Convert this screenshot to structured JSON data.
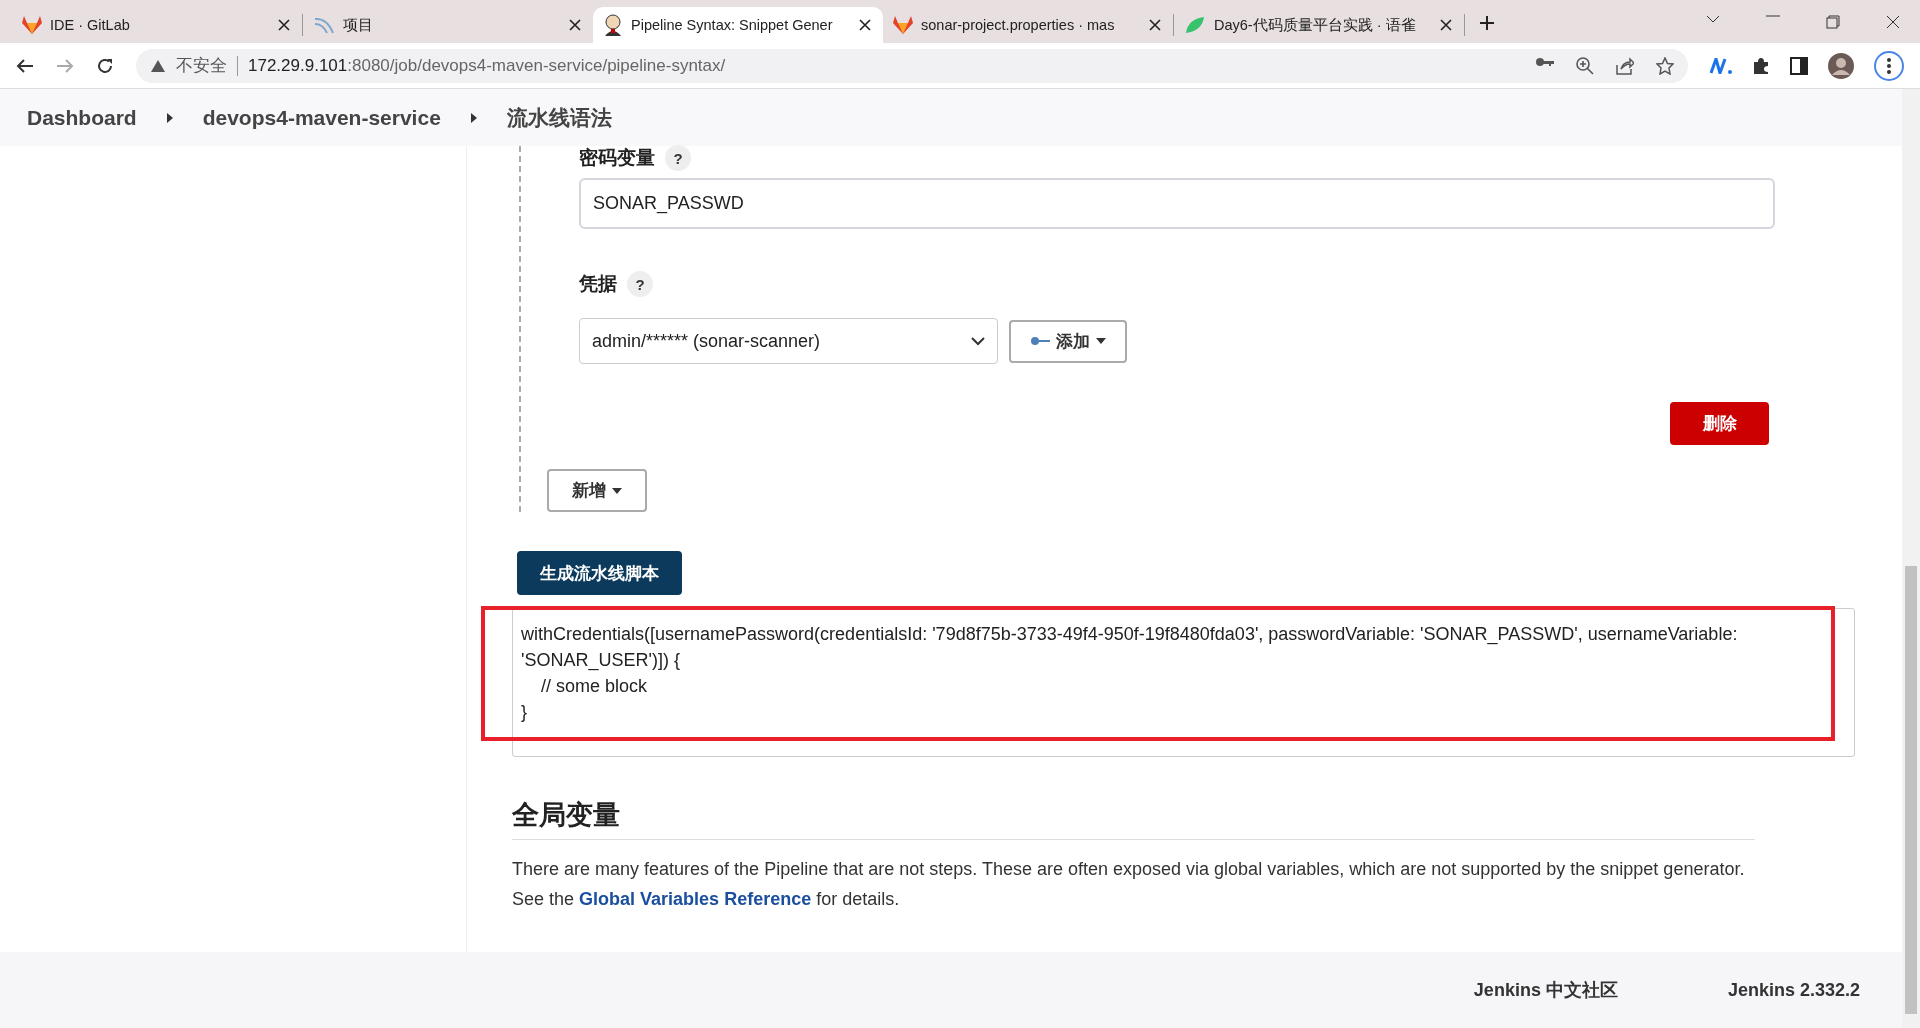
{
  "browser": {
    "tabs": [
      {
        "title": "IDE · GitLab",
        "selected": false,
        "kind": "gitlab"
      },
      {
        "title": "项目",
        "selected": false,
        "kind": "arc"
      },
      {
        "title": "Pipeline Syntax: Snippet Gener",
        "selected": true,
        "kind": "butler"
      },
      {
        "title": "sonar-project.properties · mas",
        "selected": false,
        "kind": "gitlab"
      },
      {
        "title": "Day6-代码质量平台实践 · 语雀",
        "selected": false,
        "kind": "leaf"
      }
    ],
    "address": {
      "security_label": "不安全",
      "host": "172.29.9.101",
      "rest": ":8080/job/devops4-maven-service/pipeline-syntax/"
    }
  },
  "breadcrumb": [
    "Dashboard",
    "devops4-maven-service",
    "流水线语法"
  ],
  "form": {
    "password_variable": {
      "label": "密码变量",
      "help": "?",
      "value": "SONAR_PASSWD"
    },
    "credentials": {
      "label": "凭据",
      "help": "?",
      "value": "admin/****** (sonar-scanner)",
      "add_button": "添加"
    },
    "delete_button": "删除",
    "new_button": "新增"
  },
  "generate_button": "生成流水线脚本",
  "snippet": {
    "text": "withCredentials([usernamePassword(credentialsId: '79d8f75b-3733-49f4-950f-19f8480fda03', passwordVariable: 'SONAR_PASSWD', usernameVariable: 'SONAR_USER')]) {\n    // some block\n}",
    "highlighted": true
  },
  "global_variables": {
    "heading": "全局变量",
    "line_1": "There are many features of the Pipeline that are not steps. These are often exposed via global variables, which are not supported by the snippet generator.",
    "line_2_before": "See the ",
    "link": "Global Variables Reference",
    "line_2_after": " for details."
  },
  "footer": [
    "Jenkins 中文社区",
    "Jenkins 2.332.2"
  ]
}
